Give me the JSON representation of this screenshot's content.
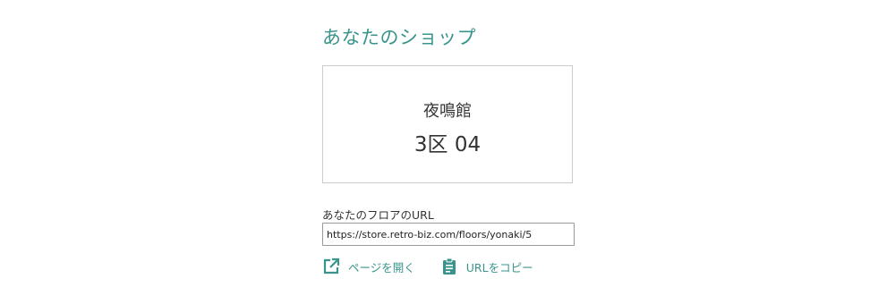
{
  "title": "あなたのショップ",
  "shop": {
    "name": "夜鳴館",
    "location": "3区 04"
  },
  "url_section": {
    "label": "あなたのフロアのURL",
    "value": "https://store.retro-biz.com/floors/yonaki/5"
  },
  "actions": {
    "open_page": {
      "label": "ページを開く",
      "icon": "external-link-icon"
    },
    "copy_url": {
      "label": "URLをコピー",
      "icon": "clipboard-icon"
    }
  },
  "colors": {
    "accent": "#3a948c",
    "text": "#333333",
    "border": "#cccccc"
  }
}
